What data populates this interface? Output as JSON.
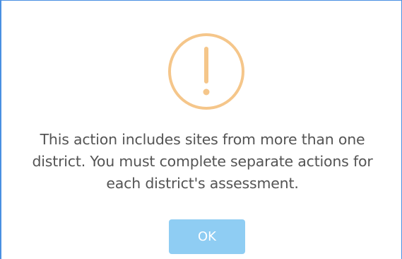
{
  "dialog": {
    "icon": "exclamation-circle-icon",
    "icon_color": "#f5c68a",
    "message_lines": [
      "This action includes sites from more than one",
      "district. You must complete separate actions for",
      "each district's assessment."
    ],
    "ok_label": "OK",
    "ok_button_color": "#8fcdf3",
    "border_color": "#4a90e2"
  }
}
